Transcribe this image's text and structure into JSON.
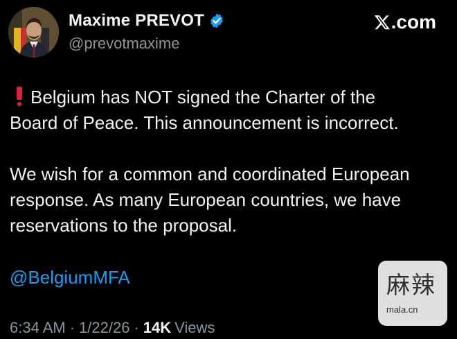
{
  "author": {
    "name": "Maxime PREVOT",
    "handle": "@prevotmaxime",
    "verified": true,
    "verified_color": "#1d9bf0"
  },
  "site": {
    "logo_text": ".com",
    "icon": "x-logo-icon"
  },
  "tweet": {
    "alert_icon": "red-exclamation-icon",
    "paragraph1": "Belgium has NOT signed the Charter of the\nBoard of Peace. This announcement is incorrect.",
    "paragraph2": "We wish for a common and coordinated European\nresponse. As many European countries, we have\nreservations to the proposal.",
    "mention": "@BelgiumMFA",
    "mention_color": "#1d9bf0"
  },
  "meta": {
    "time": "6:34 AM",
    "separator": "·",
    "date": "1/22/26",
    "views_count": "14K",
    "views_label": "Views"
  },
  "watermark": {
    "chinese": "麻辣",
    "site": "mala.cn"
  }
}
